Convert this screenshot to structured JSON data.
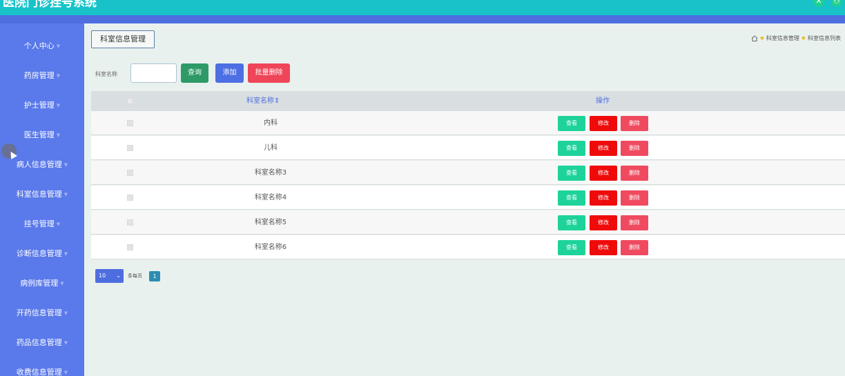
{
  "app": {
    "title": "医院门诊挂号系统"
  },
  "header_icons": [
    "close-icon",
    "user-icon"
  ],
  "sidebar": {
    "items": [
      {
        "label": "个人中心"
      },
      {
        "label": "药房管理"
      },
      {
        "label": "护士管理"
      },
      {
        "label": "医生管理"
      },
      {
        "label": "病人信息管理"
      },
      {
        "label": "科室信息管理"
      },
      {
        "label": "挂号管理"
      },
      {
        "label": "诊断信息管理"
      },
      {
        "label": "病例库管理"
      },
      {
        "label": "开药信息管理"
      },
      {
        "label": "药品信息管理"
      },
      {
        "label": "收费信息管理"
      }
    ]
  },
  "page": {
    "title": "科室信息管理",
    "breadcrumb": [
      "科室信息管理",
      "科室信息列表"
    ]
  },
  "search": {
    "label": "科室名称",
    "value": "",
    "query_label": "查询",
    "add_label": "添加",
    "batch_delete_label": "批量删除"
  },
  "table": {
    "headers": {
      "name": "科室名称",
      "sort_glyph": "⇕",
      "actions": "操作"
    },
    "rows": [
      {
        "name": "内科"
      },
      {
        "name": "儿科"
      },
      {
        "name": "科室名称3"
      },
      {
        "name": "科室名称4"
      },
      {
        "name": "科室名称5"
      },
      {
        "name": "科室名称6"
      }
    ],
    "row_actions": {
      "view": "查看",
      "edit": "修改",
      "delete": "删除"
    }
  },
  "pager": {
    "page_size": "10",
    "page_size_label": "条每页",
    "current_page": "1"
  },
  "colors": {
    "topbar": "#17c3c9",
    "sidebar": "#5a79ea",
    "accent": "#4e6ee0",
    "danger": "#f00b0b",
    "success": "#1ed39a"
  }
}
